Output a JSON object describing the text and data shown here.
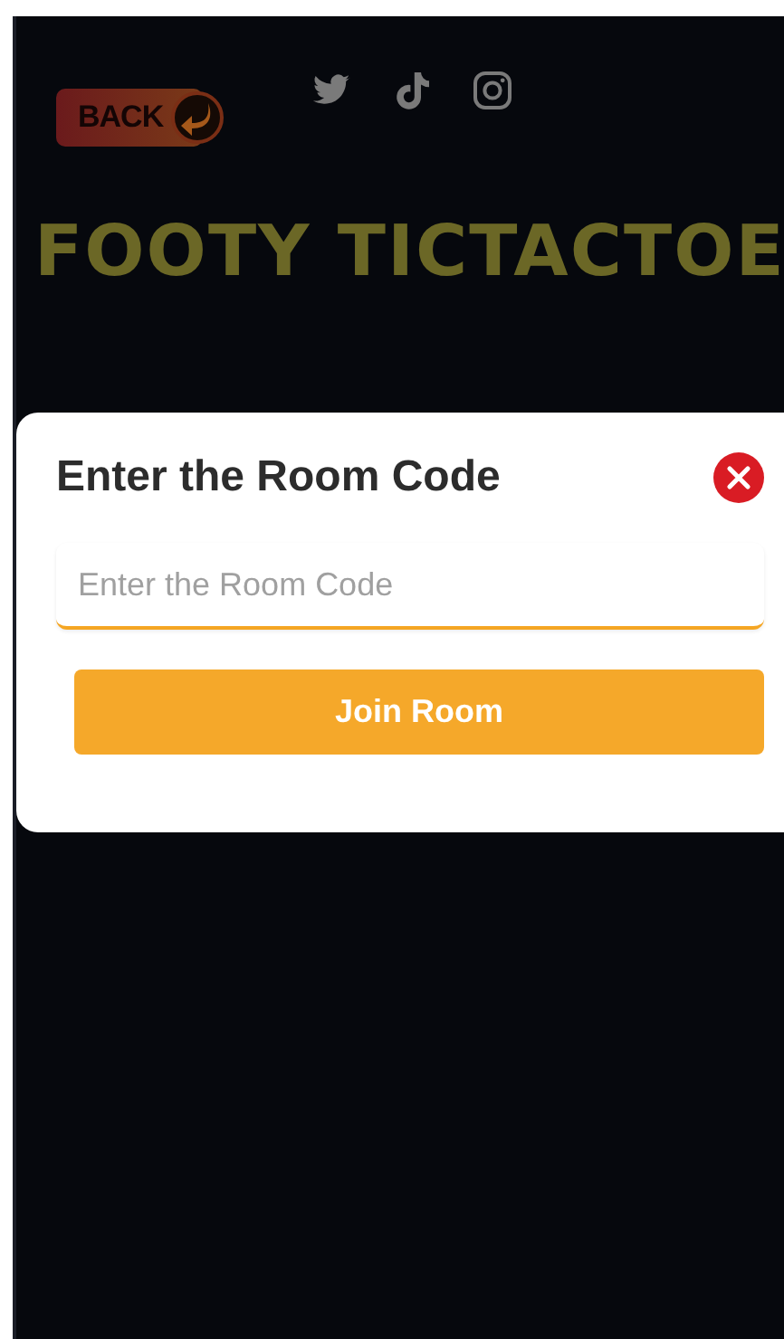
{
  "header": {
    "back_button": "BACK",
    "title": "FOOTY TICTACTOE"
  },
  "modal": {
    "title": "Enter the Room Code",
    "input": {
      "placeholder": "Enter the Room Code"
    },
    "button": "Join Room"
  }
}
